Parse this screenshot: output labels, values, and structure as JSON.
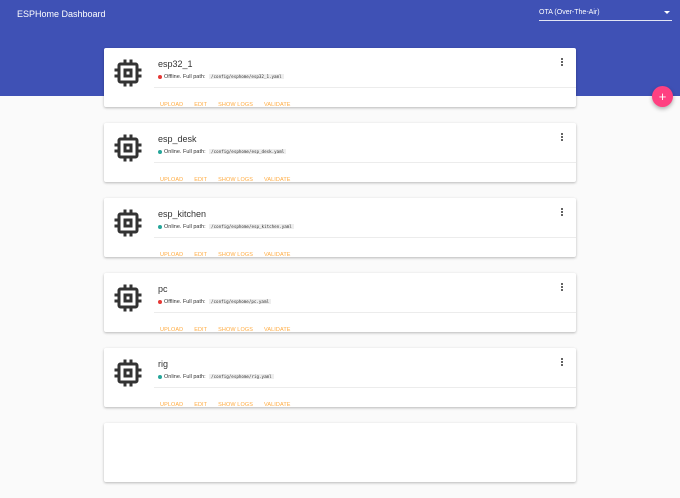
{
  "header": {
    "title": "ESPHome Dashboard"
  },
  "upload_target": {
    "selected": "OTA (Over-The-Air)"
  },
  "fab": {
    "label": "+"
  },
  "colors": {
    "primary": "#3f51b5",
    "accent": "#ff4081",
    "action": "#ffab40",
    "online": "#26a69a",
    "offline": "#e53935"
  },
  "path_label": "Full path:",
  "actions": [
    "UPLOAD",
    "EDIT",
    "SHOW LOGS",
    "VALIDATE"
  ],
  "nodes": [
    {
      "name": "esp32_1",
      "status": "Offline.",
      "path": "/config/esphome/esp32_1.yaml",
      "online": false
    },
    {
      "name": "esp_desk",
      "status": "Online.",
      "path": "/config/esphome/esp_desk.yaml",
      "online": true
    },
    {
      "name": "esp_kitchen",
      "status": "Online.",
      "path": "/config/esphome/esp_kitchen.yaml",
      "online": true
    },
    {
      "name": "pc",
      "status": "Offline.",
      "path": "/config/esphome/pc.yaml",
      "online": false
    },
    {
      "name": "rig",
      "status": "Online.",
      "path": "/config/esphome/rig.yaml",
      "online": true
    }
  ]
}
